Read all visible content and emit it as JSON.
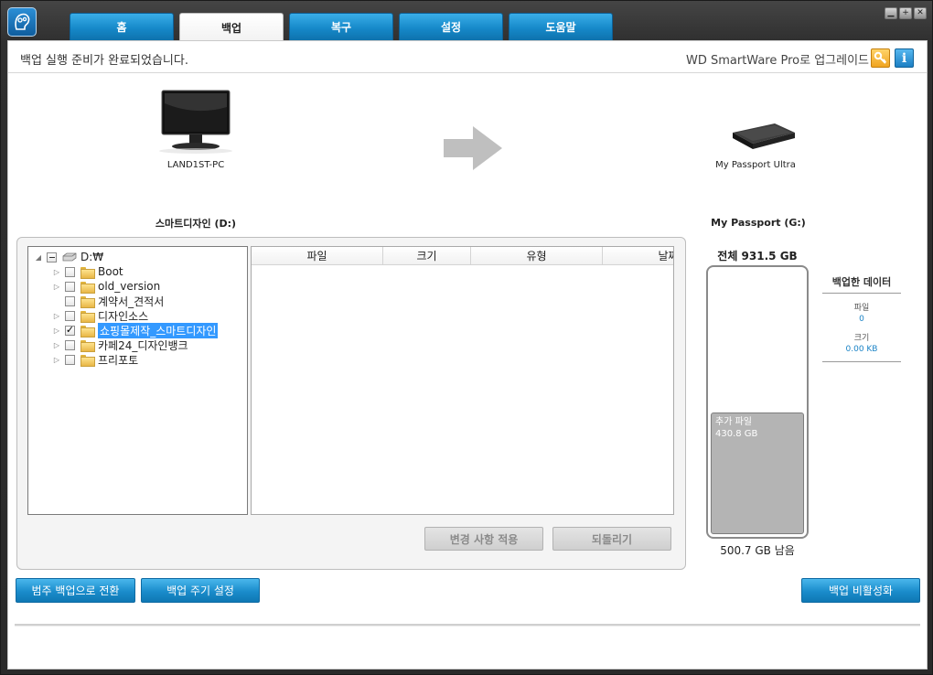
{
  "tabs": [
    {
      "label": "홈"
    },
    {
      "label": "백업"
    },
    {
      "label": "복구"
    },
    {
      "label": "설정"
    },
    {
      "label": "도움말"
    }
  ],
  "window_controls": {
    "minimize": "▁",
    "maximize": "+",
    "close": "✕"
  },
  "status": {
    "message": "백업 실행 준비가 완료되었습니다.",
    "upgrade": "WD SmartWare Pro로 업그레이드",
    "info_glyph": "i"
  },
  "source_device": {
    "name": "LAND1ST-PC",
    "drive_title": "스마트디자인 (D:)"
  },
  "target_device": {
    "name": "My Passport Ultra",
    "drive_title": "My Passport (G:)"
  },
  "tree": {
    "root": "D:₩",
    "items": [
      {
        "label": "Boot",
        "checked": false,
        "expandable": true
      },
      {
        "label": "old_version",
        "checked": false,
        "expandable": true
      },
      {
        "label": "계약서_견적서",
        "checked": false,
        "expandable": false
      },
      {
        "label": "디자인소스",
        "checked": false,
        "expandable": true
      },
      {
        "label": "쇼핑몰제작_스마트디자인",
        "checked": true,
        "expandable": true,
        "selected": true
      },
      {
        "label": "카페24_디자인뱅크",
        "checked": false,
        "expandable": true
      },
      {
        "label": "프리포토",
        "checked": false,
        "expandable": true
      }
    ]
  },
  "file_list": {
    "columns": [
      {
        "label": "파일"
      },
      {
        "label": "크기"
      },
      {
        "label": "유형"
      },
      {
        "label": "날짜"
      }
    ]
  },
  "buttons": {
    "apply": "변경 사항 적용",
    "revert": "되돌리기",
    "category_backup": "범주 백업으로 전환",
    "backup_schedule": "백업 주기 설정",
    "disable_backup": "백업 비활성화"
  },
  "capacity": {
    "total": "전체 931.5 GB",
    "extra_label": "추가 파일",
    "extra_size": "430.8 GB",
    "extra_fraction": 0.46,
    "free": "500.7 GB 남음"
  },
  "backup_data": {
    "title": "백업한 데이터",
    "files_label": "파일",
    "files_value": "0",
    "size_label": "크기",
    "size_value": "0.00 KB"
  },
  "colors": {
    "accent": "#1a8ccb",
    "selection": "#3399ff"
  }
}
